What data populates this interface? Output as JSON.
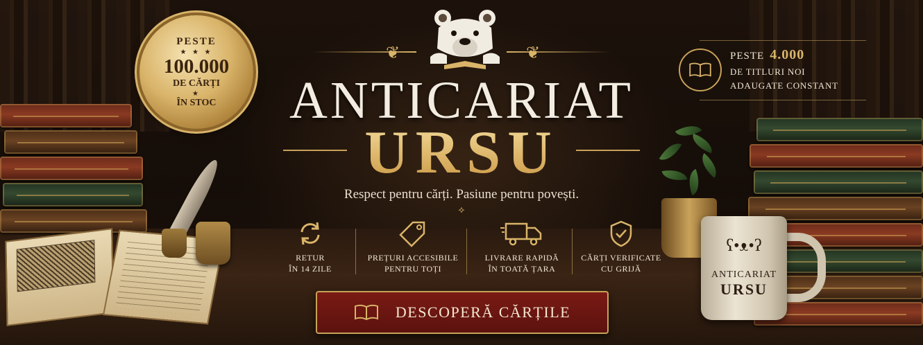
{
  "seal": {
    "line1": "PESTE",
    "stars": "★ ★ ★",
    "number": "100.000",
    "line2": "DE CĂRȚI",
    "line3": "ÎN STOC"
  },
  "brand": {
    "title_line1": "ANTICARIAT",
    "title_line2": "URSU",
    "tagline": "Respect pentru cărți. Pasiune pentru povești.",
    "ornament": "⟡"
  },
  "badge": {
    "prefix": "PESTE",
    "count": "4.000",
    "line2": "DE TITLURI NOI",
    "line3": "ADAUGATE CONSTANT"
  },
  "features": [
    {
      "icon": "refresh-icon",
      "line1": "RETUR",
      "line2": "ÎN 14 ZILE"
    },
    {
      "icon": "price-tag-icon",
      "line1": "PREȚURI ACCESIBILE",
      "line2": "PENTRU TOȚI"
    },
    {
      "icon": "delivery-truck-icon",
      "line1": "LIVRARE RAPIDĂ",
      "line2": "ÎN TOATĂ ȚARA"
    },
    {
      "icon": "shield-check-icon",
      "line1": "CĂRȚI VERIFICATE",
      "line2": "CU GRIJĂ"
    }
  ],
  "cta": {
    "label": "DESCOPERĂ CĂRȚILE",
    "icon": "open-book-icon"
  },
  "mug": {
    "line1": "ANTICARIAT",
    "line2": "URSU"
  },
  "colors": {
    "gold": "#d9b469",
    "burgundy": "#6a1510",
    "cream": "#efe6d4",
    "background": "#150d08"
  }
}
